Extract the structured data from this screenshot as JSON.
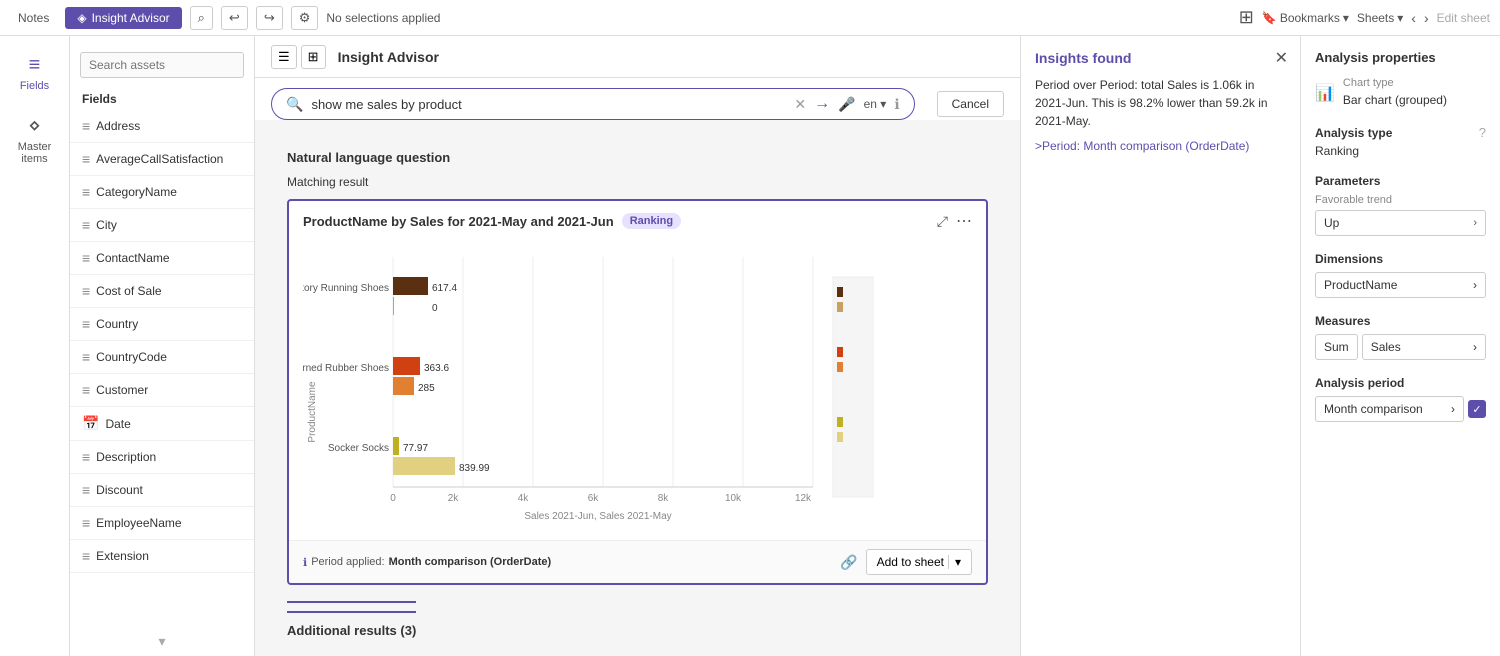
{
  "topbar": {
    "notes_label": "Notes",
    "insight_advisor_label": "Insight Advisor",
    "no_selections": "No selections applied",
    "bookmarks_label": "Bookmarks",
    "sheets_label": "Sheets",
    "edit_sheet_label": "Edit sheet"
  },
  "sidebar": {
    "fields_label": "Fields",
    "master_items_label": "Master items"
  },
  "fields_panel": {
    "search_placeholder": "Search assets",
    "section_title": "Fields",
    "items": [
      {
        "label": "Address",
        "icon": "field"
      },
      {
        "label": "AverageCallSatisfaction",
        "icon": "field"
      },
      {
        "label": "CategoryName",
        "icon": "field"
      },
      {
        "label": "City",
        "icon": "field"
      },
      {
        "label": "ContactName",
        "icon": "field"
      },
      {
        "label": "Cost of Sale",
        "icon": "field"
      },
      {
        "label": "Country",
        "icon": "field"
      },
      {
        "label": "CountryCode",
        "icon": "field"
      },
      {
        "label": "Customer",
        "icon": "field"
      },
      {
        "label": "Date",
        "icon": "calendar"
      },
      {
        "label": "Description",
        "icon": "field"
      },
      {
        "label": "Discount",
        "icon": "field"
      },
      {
        "label": "EmployeeName",
        "icon": "field"
      },
      {
        "label": "Extension",
        "icon": "field"
      }
    ]
  },
  "ia_header": {
    "title": "Insight Advisor",
    "nlq_title": "Natural language question",
    "cancel_label": "Cancel",
    "search_value": "show me sales by product",
    "lang": "en",
    "matching_result": "Matching result"
  },
  "chart": {
    "title": "ProductName by Sales for 2021-May and 2021-Jun",
    "badge": "Ranking",
    "period_label": "Period applied:",
    "period_value": "Month comparison (OrderDate)",
    "add_sheet_label": "Add to sheet",
    "products": [
      {
        "name": "Victory Running Shoes",
        "val_may": 617.4,
        "val_jun": 0
      },
      {
        "name": "Burned Rubber Shoes",
        "val_may": 363.6,
        "val_jun": 285
      },
      {
        "name": "Socker Socks",
        "val_may": 77.97,
        "val_jun": 839.99
      }
    ],
    "x_labels": [
      "0",
      "2k",
      "4k",
      "6k",
      "8k",
      "10k",
      "12k"
    ],
    "x_axis_label": "Sales 2021-Jun, Sales 2021-May",
    "y_axis_label": "ProductName"
  },
  "insights": {
    "title": "Insights found",
    "text": "Period over Period: total Sales is 1.06k in 2021-Jun. This is 98.2% lower than 59.2k in 2021-May.",
    "link": ">Period: Month comparison (OrderDate)"
  },
  "additional_results": {
    "label": "Additional results (3)"
  },
  "analysis_properties": {
    "title": "Analysis properties",
    "chart_type_label": "Chart type",
    "chart_type_value": "Bar chart (grouped)",
    "analysis_type_label": "Analysis type",
    "analysis_type_help": "?",
    "analysis_type_value": "Ranking",
    "parameters_label": "Parameters",
    "favorable_trend_label": "Favorable trend",
    "favorable_trend_value": "Up",
    "dimensions_label": "Dimensions",
    "dimension_value": "ProductName",
    "measures_label": "Measures",
    "measure_sum": "Sum",
    "measure_value": "Sales",
    "analysis_period_label": "Analysis period",
    "analysis_period_value": "Month comparison"
  }
}
